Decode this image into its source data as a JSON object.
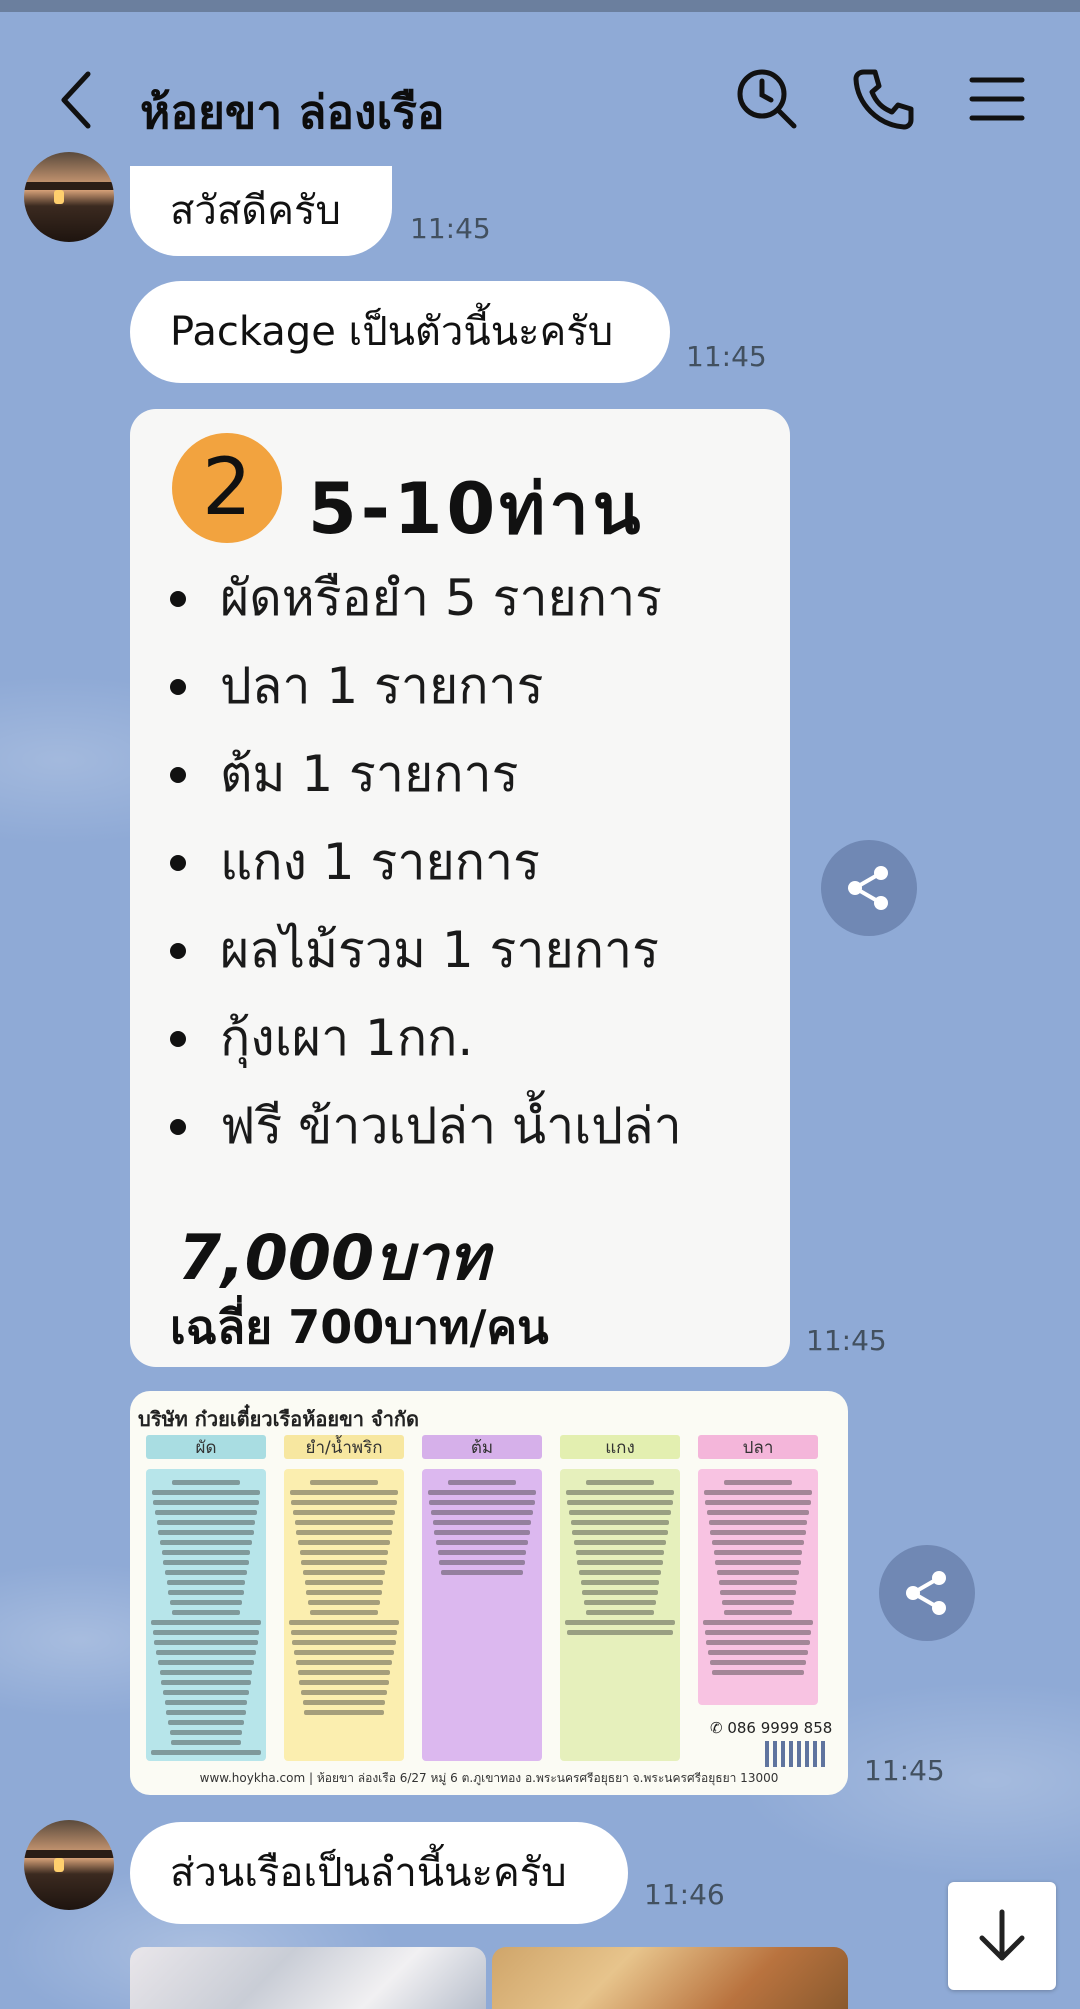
{
  "header": {
    "title": "ห้อยขา ล่องเรือ",
    "icons": [
      "back-arrow-icon",
      "search-clock-icon",
      "phone-icon",
      "menu-icon"
    ]
  },
  "messages": {
    "m1": {
      "text": "สวัสดีครับ",
      "time": "11:45"
    },
    "m2": {
      "text": "Package เป็นตัวนี้นะครับ",
      "time": "11:45"
    },
    "m3": {
      "time": "11:45",
      "package": {
        "number": "2",
        "heading": "5-10ท่าน",
        "items": [
          "ผัดหรือยำ 5 รายการ",
          "ปลา 1 รายการ",
          "ต้ม 1 รายการ",
          "แกง 1 รายการ",
          "ผลไม้รวม 1 รายการ",
          "กุ้งเผา 1กก.",
          "ฟรี ข้าวเปล่า น้ำเปล่า"
        ],
        "price": "7,000บาท",
        "average": "เฉลี่ย 700บาท/คน"
      }
    },
    "m4": {
      "time": "11:45",
      "menu": {
        "company": "บริษัท ก๋วยเตี๋ยวเรือห้อยขา จำกัด",
        "columns": [
          {
            "label": "ผัด",
            "head_color": "#a9dde2",
            "body_color": "#b7e5ea"
          },
          {
            "label": "ยำ/น้ำพริก",
            "head_color": "#f7e7a0",
            "body_color": "#fbeeaf"
          },
          {
            "label": "ต้ม",
            "head_color": "#d6b0ea",
            "body_color": "#dcb8ef"
          },
          {
            "label": "แกง",
            "head_color": "#e3efb0",
            "body_color": "#e6f0bc"
          },
          {
            "label": "ปลา",
            "head_color": "#f4b6da",
            "body_color": "#f8c3e2"
          }
        ],
        "phone": "086 9999 858",
        "footer": "www.hoykha.com | ห้อยขา ล่องเรือ 6/27 หมู่ 6 ต.ภูเขาทอง อ.พระนครศรีอยุธยา จ.พระนครศรีอยุธยา 13000"
      }
    },
    "m5": {
      "text": "ส่วนเรือเป็นลำนี้นะครับ",
      "time": "11:46"
    }
  },
  "colors": {
    "background": "#8faad6",
    "bubble": "#ffffff",
    "share_button": "#7088b4",
    "package_badge": "#f2a33f"
  }
}
